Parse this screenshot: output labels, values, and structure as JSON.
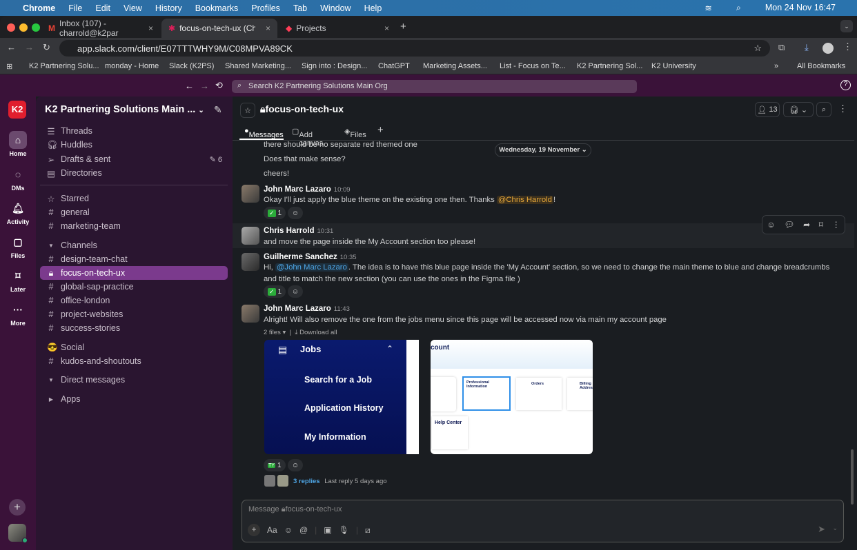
{
  "menubar": {
    "app": "Chrome",
    "items": [
      "File",
      "Edit",
      "View",
      "History",
      "Bookmarks",
      "Profiles",
      "Tab",
      "Window",
      "Help"
    ],
    "clock": "Mon 24 Nov  16:47"
  },
  "browser": {
    "tabs": [
      {
        "label": "Inbox (107) - charrold@k2par"
      },
      {
        "label": "focus-on-tech-ux (Channel) -"
      },
      {
        "label": "Projects"
      }
    ],
    "url": "app.slack.com/client/E07TTTWHY9M/C08MPVA89CK",
    "bookmarks": [
      "K2 Partnering Solu...",
      "monday - Home",
      "Slack (K2PS)",
      "Shared Marketing...",
      "Sign into : Design...",
      "ChatGPT",
      "Marketing Assets...",
      "List - Focus on Te...",
      "K2 Partnering Sol...",
      "K2 University"
    ],
    "all_bookmarks": "All Bookmarks"
  },
  "slack": {
    "search_placeholder": "Search K2 Partnering Solutions Main Org",
    "rail": [
      {
        "label": "Home"
      },
      {
        "label": "DMs"
      },
      {
        "label": "Activity"
      },
      {
        "label": "Files"
      },
      {
        "label": "Later"
      },
      {
        "label": "More"
      }
    ],
    "workspace": "K2 Partnering Solutions Main ...",
    "nav": [
      {
        "label": "Threads"
      },
      {
        "label": "Huddles"
      },
      {
        "label": "Drafts & sent",
        "count": "6"
      },
      {
        "label": "Directories"
      }
    ],
    "starred": {
      "header": "Starred",
      "items": [
        "general",
        "marketing-team"
      ]
    },
    "channels": {
      "header": "Channels",
      "items": [
        "design-team-chat",
        "focus-on-tech-ux",
        "global-sap-practice",
        "office-london",
        "project-websites",
        "success-stories"
      ]
    },
    "social": {
      "header": "Social",
      "items": [
        "kudos-and-shoutouts"
      ]
    },
    "dm_header": "Direct messages",
    "apps_header": "Apps",
    "channel": {
      "name": "focus-on-tech-ux",
      "members": "13",
      "tabs": [
        "Messages",
        "Add canvas",
        "Files"
      ]
    },
    "date_divider": "Wednesday, 19 November",
    "prev_lines": [
      "there should be no separate red themed one",
      "Does that make sense?",
      "cheers!"
    ],
    "messages": [
      {
        "author": "John Marc Lazaro",
        "time": "10:09",
        "text": "Okay I'll just apply the blue theme on the existing one then. Thanks ",
        "mention": "@Chris Harrold",
        "tail": "!",
        "reaction": "1"
      },
      {
        "author": "Chris Harrold",
        "time": "10:31",
        "text": "and move the page inside the My Account section too please!"
      },
      {
        "author": "Guilherme Sanchez",
        "time": "10:35",
        "pre": "Hi, ",
        "mention": "@John Marc Lazaro",
        "text": ". The idea is to have this blue page inside the 'My Account' section, so we need to change the main theme to blue and change breadcrumbs and title to match the new section (you can use the ones in the Figma file )",
        "reaction": "1"
      },
      {
        "author": "John Marc Lazaro",
        "time": "11:43",
        "text": "Alright! Will also remove the one from the jobs menu since this page will be accessed now via main my account page",
        "files": "2 files",
        "download": "Download all",
        "reaction": "1",
        "replies": "3 replies",
        "last_reply": "Last reply 5 days ago"
      }
    ],
    "attachment1": {
      "title": "Jobs",
      "items": [
        "Search for a Job",
        "Application History",
        "My Information"
      ]
    },
    "attachment2": {
      "title": "count",
      "cards": [
        "Professional Information",
        "Orders",
        "Billing Address",
        "Help Center"
      ]
    },
    "composer_placeholder": "Message",
    "composer_channel": "focus-on-tech-ux"
  }
}
